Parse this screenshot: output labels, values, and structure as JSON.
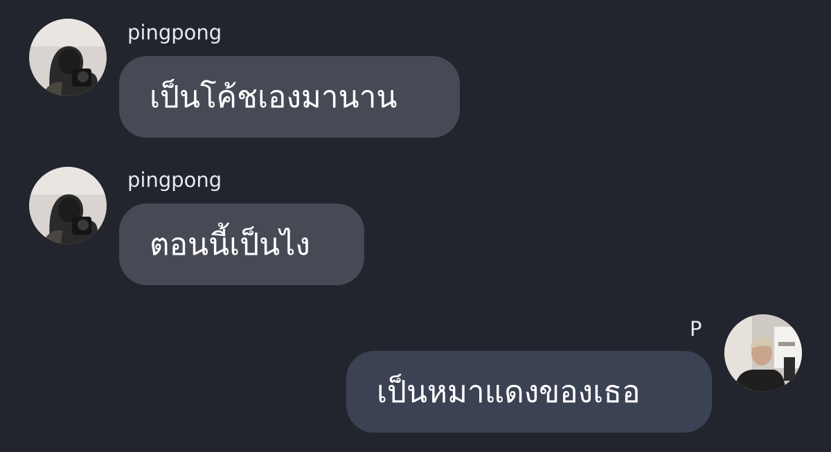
{
  "conversation": {
    "messages": [
      {
        "direction": "incoming",
        "sender": "pingpong",
        "avatar": "pingpong-avatar",
        "text": "เป็นโค้ชเองมานาน"
      },
      {
        "direction": "incoming",
        "sender": "pingpong",
        "avatar": "pingpong-avatar",
        "text": "ตอนนี้เป็นไง"
      },
      {
        "direction": "outgoing",
        "sender": "P",
        "avatar": "p-avatar",
        "text": "เป็นหมาแดงของเธอ"
      }
    ]
  },
  "colors": {
    "background": "#22252d",
    "incoming_bubble": "#474a55",
    "outgoing_bubble": "#3b4253",
    "text": "#ffffff"
  }
}
